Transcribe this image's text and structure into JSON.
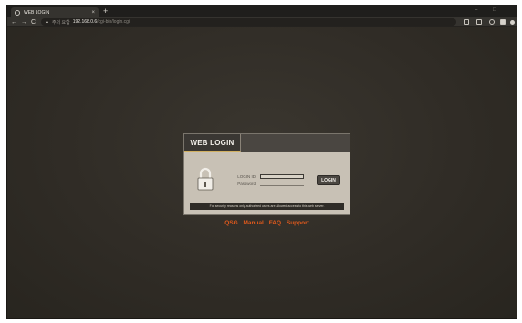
{
  "browser": {
    "tab_title": "WEB LOGIN",
    "tab_close": "×",
    "new_tab": "+",
    "nav": {
      "back": "←",
      "forward": "→",
      "reload": "C"
    },
    "address": {
      "warning_glyph": "▲",
      "not_secure_label": "주의 요함",
      "host": "192.168.0.6",
      "path": "/cgi-bin/login.cgi"
    }
  },
  "login": {
    "title": "WEB LOGIN",
    "id_label": "LOGIN ID",
    "password_label": "Password",
    "id_value": "",
    "password_value": "",
    "button_label": "LOGIN",
    "notice": "For security reasons only authorized users are allowed access to this web server."
  },
  "links": [
    "QSG",
    "Manual",
    "FAQ",
    "Support"
  ],
  "colors": {
    "page_background": "#2e2b26",
    "link": "#e25a1c",
    "panel": "#c8c1b5",
    "header": "#4a4641"
  }
}
